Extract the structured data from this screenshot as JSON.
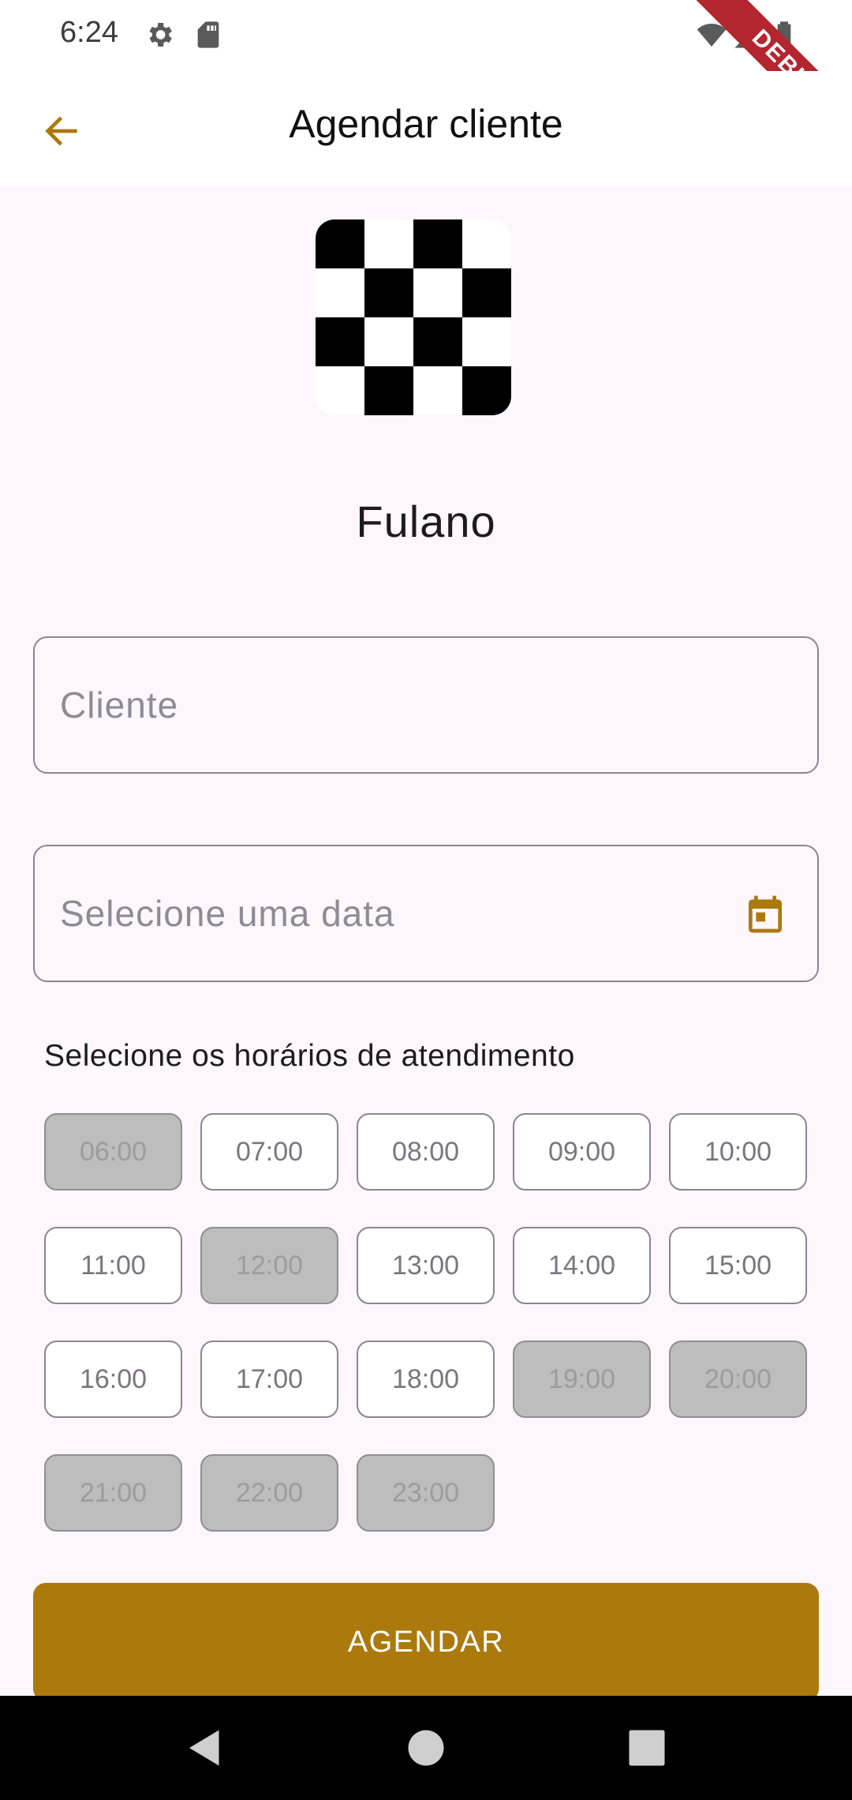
{
  "status_bar": {
    "time": "6:24",
    "icons": [
      "gear-icon",
      "sd-card-icon",
      "wifi-icon",
      "signal-icon",
      "battery-icon"
    ],
    "debug_label": "DEBUG"
  },
  "app_bar": {
    "title": "Agendar cliente",
    "back_icon": "arrow-back-icon"
  },
  "profile": {
    "name": "Fulano"
  },
  "form": {
    "client_placeholder": "Cliente",
    "date_placeholder": "Selecione uma data",
    "date_icon": "calendar-icon"
  },
  "schedule": {
    "title": "Selecione os horários de atendimento",
    "slots": [
      {
        "label": "06:00",
        "disabled": true
      },
      {
        "label": "07:00",
        "disabled": false
      },
      {
        "label": "08:00",
        "disabled": false
      },
      {
        "label": "09:00",
        "disabled": false
      },
      {
        "label": "10:00",
        "disabled": false
      },
      {
        "label": "11:00",
        "disabled": false
      },
      {
        "label": "12:00",
        "disabled": true
      },
      {
        "label": "13:00",
        "disabled": false
      },
      {
        "label": "14:00",
        "disabled": false
      },
      {
        "label": "15:00",
        "disabled": false
      },
      {
        "label": "16:00",
        "disabled": false
      },
      {
        "label": "17:00",
        "disabled": false
      },
      {
        "label": "18:00",
        "disabled": false
      },
      {
        "label": "19:00",
        "disabled": true
      },
      {
        "label": "20:00",
        "disabled": true
      },
      {
        "label": "21:00",
        "disabled": true
      },
      {
        "label": "22:00",
        "disabled": true
      },
      {
        "label": "23:00",
        "disabled": true
      }
    ]
  },
  "actions": {
    "submit_label": "AGENDAR"
  },
  "colors": {
    "accent": "#ac790d",
    "background": "#fdf7fb",
    "disabled_slot": "#bdbdbd"
  },
  "nav_bar": {
    "icons": [
      "back-triangle-icon",
      "home-circle-icon",
      "recents-square-icon"
    ]
  }
}
